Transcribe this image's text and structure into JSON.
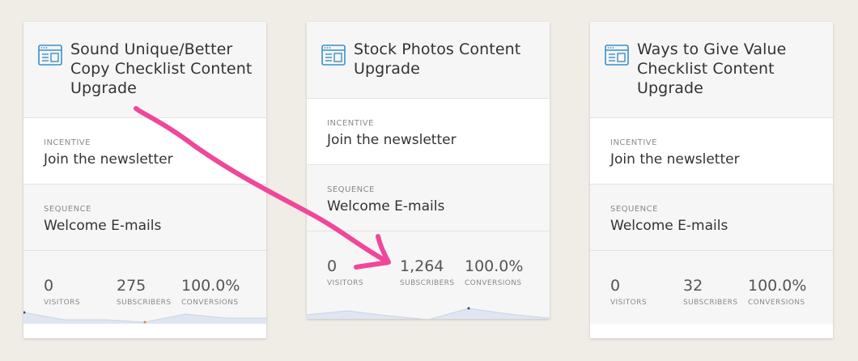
{
  "cards": [
    {
      "title_lines": [
        "Sound Unique/Better",
        "Copy Checklist Content",
        "Upgrade"
      ],
      "incentive_label": "INCENTIVE",
      "incentive_value": "Join the newsletter",
      "sequence_label": "SEQUENCE",
      "sequence_value": "Welcome E-mails",
      "visitors": "0",
      "visitors_label": "VISITORS",
      "subscribers": "275",
      "subscribers_label": "SUBSCRIBERS",
      "conversions": "100.0%",
      "conversions_label": "CONVERSIONS"
    },
    {
      "title_lines": [
        "Stock Photos Content",
        "Upgrade"
      ],
      "incentive_label": "INCENTIVE",
      "incentive_value": "Join the newsletter",
      "sequence_label": "SEQUENCE",
      "sequence_value": "Welcome E-mails",
      "visitors": "0",
      "visitors_label": "VISITORS",
      "subscribers": "1,264",
      "subscribers_label": "SUBSCRIBERS",
      "conversions": "100.0%",
      "conversions_label": "CONVERSIONS"
    },
    {
      "title_lines": [
        "Ways to Give Value",
        "Checklist Content",
        "Upgrade"
      ],
      "incentive_label": "INCENTIVE",
      "incentive_value": "Join the newsletter",
      "sequence_label": "SEQUENCE",
      "sequence_value": "Welcome E-mails",
      "visitors": "0",
      "visitors_label": "VISITORS",
      "subscribers": "32",
      "subscribers_label": "SUBSCRIBERS",
      "conversions": "100.0%",
      "conversions_label": "CONVERSIONS"
    }
  ],
  "colors": {
    "accent_icon": "#3a8fc9",
    "annotation_arrow": "#f0479a",
    "sparkline_fill": "#dfe6f2"
  }
}
